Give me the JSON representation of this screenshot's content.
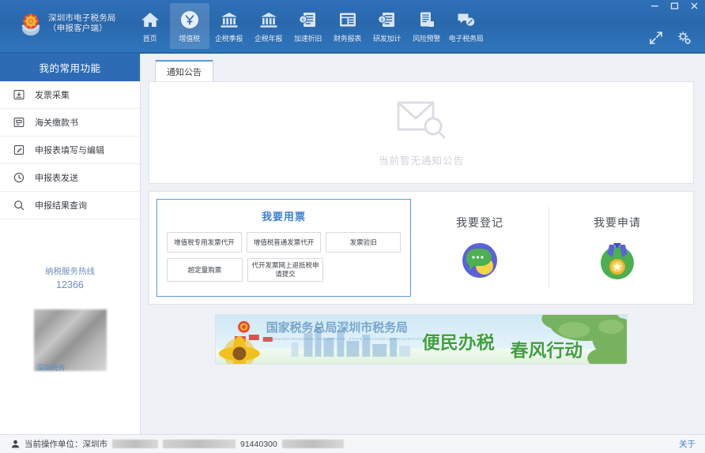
{
  "window": {
    "minimize_label": "—",
    "maximize_label": "□",
    "close_label": "✕"
  },
  "header": {
    "logo": {
      "icon": "tax-emblem-icon",
      "line1": "深圳市电子税务局",
      "line2": "（申报客户端）"
    },
    "nav": [
      {
        "label": "首页",
        "icon": "home-icon",
        "active": false
      },
      {
        "label": "增值税",
        "icon": "vat-icon",
        "active": true
      },
      {
        "label": "企税季报",
        "icon": "bank-icon",
        "active": false
      },
      {
        "label": "企税年报",
        "icon": "bank-icon",
        "active": false
      },
      {
        "label": "加速折旧",
        "icon": "coin-doc-icon",
        "active": false
      },
      {
        "label": "财务报表",
        "icon": "report-icon",
        "active": false
      },
      {
        "label": "研发加计",
        "icon": "coin-doc-icon",
        "active": false
      },
      {
        "label": "风险预警",
        "icon": "risk-doc-icon",
        "active": false
      },
      {
        "label": "电子税务局",
        "icon": "screen-link-icon",
        "active": false
      }
    ],
    "tools": [
      {
        "icon": "fullscreen-icon"
      },
      {
        "icon": "gear-settings-icon"
      }
    ]
  },
  "sidebar": {
    "title": "我的常用功能",
    "items": [
      {
        "label": "发票采集",
        "icon": "inbox-download-icon"
      },
      {
        "label": "海关缴款书",
        "icon": "document-box-icon"
      },
      {
        "label": "申报表填写与编辑",
        "icon": "edit-square-icon"
      },
      {
        "label": "申报表发送",
        "icon": "send-clock-icon"
      },
      {
        "label": "申报结果查询",
        "icon": "search-icon"
      }
    ],
    "hotline_label": "纳税服务热线",
    "hotline_number": "12366",
    "photo_caption": "深圳税务"
  },
  "main": {
    "tabs": [
      {
        "label": "通知公告",
        "active": true
      }
    ],
    "notice": {
      "icon": "envelope-search-icon",
      "empty_text": "当前暂无通知公告"
    },
    "invoice_card": {
      "title": "我要用票",
      "buttons_row1": [
        "增值税专用发票代开",
        "增值税普通发票代开",
        "发票验旧"
      ],
      "buttons_row2": [
        "超定量购票",
        "代开发票网上退抵税申请提交"
      ]
    },
    "tiles": [
      {
        "title": "我要登记",
        "icon": "chat-bubble-circle-icon"
      },
      {
        "title": "我要申请",
        "icon": "medal-icon"
      }
    ],
    "banner": {
      "emblem": "tax-emblem-icon",
      "org_name": "国家税务总局深圳市税务局",
      "org_name_en": "SHENZHEN MUNICIPAL TAX SERVICE, STATE TAXATION ADMINISTRATION",
      "slogan1": "便民办税",
      "slogan2": "春风行动"
    }
  },
  "statusbar": {
    "user_icon": "user-icon",
    "label": "当前操作单位：深圳市",
    "tax_id_fragment": "91440300",
    "link_label": "关于"
  },
  "colors": {
    "header_blue": "#2e6fb7",
    "sidebar_header_blue": "#2d6cb5",
    "accent_blue": "#3f7fd0",
    "card_border_blue": "#5b9bd5",
    "page_bg": "#eef1f6",
    "tile_green": "#4caf50",
    "tile_purple": "#5b62d8",
    "tile_yellow": "#f5d547"
  }
}
